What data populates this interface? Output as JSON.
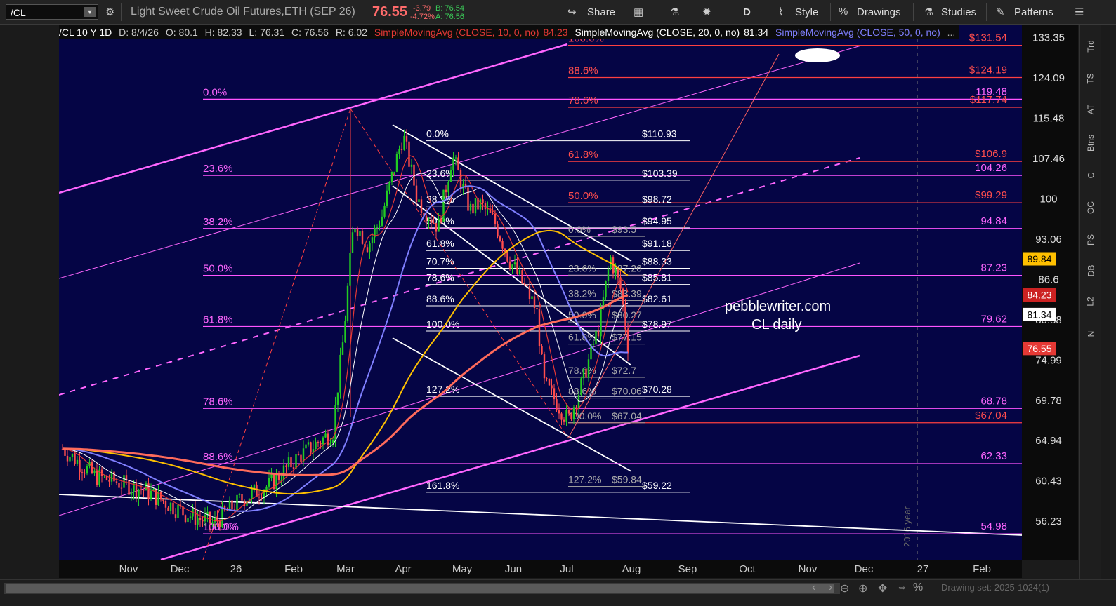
{
  "toolbar": {
    "symbol": "/CL",
    "title": "Light Sweet Crude Oil Futures,ETH (SEP 26)",
    "last_price": "76.55",
    "change": "-3.79",
    "change_pct": "-4.72%",
    "bid": "B: 76.54",
    "ask": "A: 76.56",
    "share": "Share",
    "period": "D",
    "style": "Style",
    "drawings": "Drawings",
    "studies": "Studies",
    "patterns": "Patterns"
  },
  "infobar": {
    "sym": "/CL 10 Y 1D",
    "date": "D: 8/4/26",
    "open": "O: 80.1",
    "high": "H: 82.33",
    "low": "L: 76.31",
    "close": "C: 76.56",
    "range": "R: 6.02",
    "sma10_label": "SimpleMovingAvg (CLOSE, 10, 0, no)",
    "sma10_val": "84.23",
    "sma20_label": "SimpleMovingAvg (CLOSE, 20, 0, no)",
    "sma20_val": "81.34",
    "sma50_label": "SimpleMovingAvg (CLOSE, 50, 0, no)",
    "more": "..."
  },
  "side_tabs": [
    "Trd",
    "TS",
    "AT",
    "Btns",
    "C",
    "OC",
    "PS",
    "DB",
    "L2",
    "N"
  ],
  "bottom": {
    "drawing_set": "Drawing set: 2025-1024(1)"
  },
  "chart_data": {
    "type": "candlestick",
    "watermark": "pebblewriter.com\nCL daily",
    "year_label": "2016 year",
    "ylim": [
      52.5,
      136.5
    ],
    "y_ticks": [
      "133.35",
      "124.09",
      "115.48",
      "107.46",
      "100",
      "93.06",
      "86.6",
      "80.58",
      "74.99",
      "69.78",
      "64.94",
      "60.43",
      "56.23"
    ],
    "x_ticks": [
      "Nov",
      "Dec",
      "26",
      "Feb",
      "Mar",
      "Apr",
      "May",
      "Jun",
      "Jul",
      "Aug",
      "Sep",
      "Oct",
      "Nov",
      "Dec",
      "27",
      "Feb"
    ],
    "price_badges": [
      {
        "label": "89.84",
        "color": "#ffc000"
      },
      {
        "label": "84.23",
        "color": "#cc2222"
      },
      {
        "label": "81.34",
        "color": "#ffffff"
      },
      {
        "label": "76.55",
        "color": "#e53935"
      }
    ],
    "fib_magenta_left": [
      {
        "pct": "0.0%",
        "price": 119.48
      },
      {
        "pct": "23.6%",
        "price": 104.26
      },
      {
        "pct": "38.2%",
        "price": 94.84
      },
      {
        "pct": "50.0%",
        "price": 87.23
      },
      {
        "pct": "61.8%",
        "price": 79.62
      },
      {
        "pct": "78.6%",
        "price": 68.78
      },
      {
        "pct": "88.6%",
        "price": 62.33
      },
      {
        "pct": "100.0%",
        "price": 54.98
      }
    ],
    "fib_red_right": [
      {
        "pct": "100.0%",
        "price": 131.54
      },
      {
        "pct": "88.6%",
        "price": 124.19
      },
      {
        "pct": "78.6%",
        "price": 117.74
      },
      {
        "pct": "61.8%",
        "price": 106.9
      },
      {
        "pct": "50.0%",
        "price": 99.29
      },
      {
        "pct": "",
        "price": 67.04
      }
    ],
    "fib_white": [
      {
        "pct": "0.0%",
        "price": 110.93
      },
      {
        "pct": "23.6%",
        "price": 103.39
      },
      {
        "pct": "38.2%",
        "price": 98.72
      },
      {
        "pct": "50.0%",
        "price": 94.95
      },
      {
        "pct": "61.8%",
        "price": 91.18
      },
      {
        "pct": "70.7%",
        "price": 88.33
      },
      {
        "pct": "78.6%",
        "price": 85.81
      },
      {
        "pct": "88.6%",
        "price": 82.61
      },
      {
        "pct": "100.0%",
        "price": 78.97
      },
      {
        "pct": "127.2%",
        "price": 70.28
      },
      {
        "pct": "161.8%",
        "price": 59.22
      }
    ],
    "fib_gray": [
      {
        "pct": "0.0%",
        "price": 93.5
      },
      {
        "pct": "23.6%",
        "price": 87.26
      },
      {
        "pct": "38.2%",
        "price": 83.39
      },
      {
        "pct": "50.0%",
        "price": 80.27
      },
      {
        "pct": "61.8%",
        "price": 77.15
      },
      {
        "pct": "78.6%",
        "price": 72.7
      },
      {
        "pct": "88.6%",
        "price": 70.06
      },
      {
        "pct": "100.0%",
        "price": 67.04
      },
      {
        "pct": "127.2%",
        "price": 59.84
      }
    ],
    "extra_labels": [
      {
        "pct": "100.0%",
        "price": 54.98
      }
    ]
  }
}
